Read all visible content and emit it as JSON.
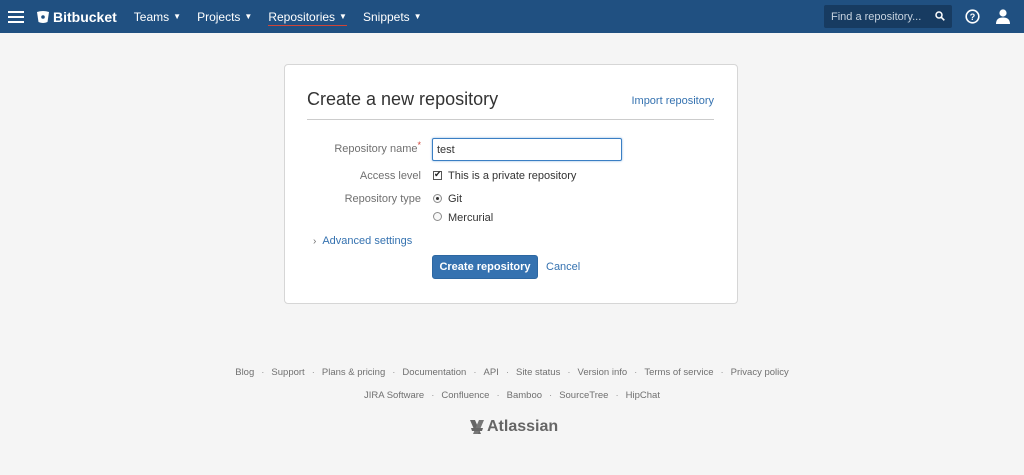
{
  "nav": {
    "brand": "Bitbucket",
    "items": [
      {
        "label": "Teams"
      },
      {
        "label": "Projects"
      },
      {
        "label": "Repositories"
      },
      {
        "label": "Snippets"
      }
    ],
    "search_placeholder": "Find a repository..."
  },
  "form": {
    "title": "Create a new repository",
    "import_link": "Import repository",
    "repo_name_label": "Repository name",
    "required_mark": "*",
    "repo_name_value": "test",
    "access_level_label": "Access level",
    "private_label": "This is a private repository",
    "private_checked": true,
    "repo_type_label": "Repository type",
    "repo_types": [
      {
        "label": "Git",
        "selected": true
      },
      {
        "label": "Mercurial",
        "selected": false
      }
    ],
    "advanced_settings": "Advanced settings",
    "create_button": "Create repository",
    "cancel_link": "Cancel"
  },
  "footer": {
    "row1": [
      "Blog",
      "Support",
      "Plans & pricing",
      "Documentation",
      "API",
      "Site status",
      "Version info",
      "Terms of service",
      "Privacy policy"
    ],
    "row2": [
      "JIRA Software",
      "Confluence",
      "Bamboo",
      "SourceTree",
      "HipChat"
    ],
    "brand": "Atlassian"
  },
  "colors": {
    "nav_bg": "#205081",
    "link": "#3572b0",
    "primary_button": "#3572b0",
    "active_underline": "#d04437"
  }
}
